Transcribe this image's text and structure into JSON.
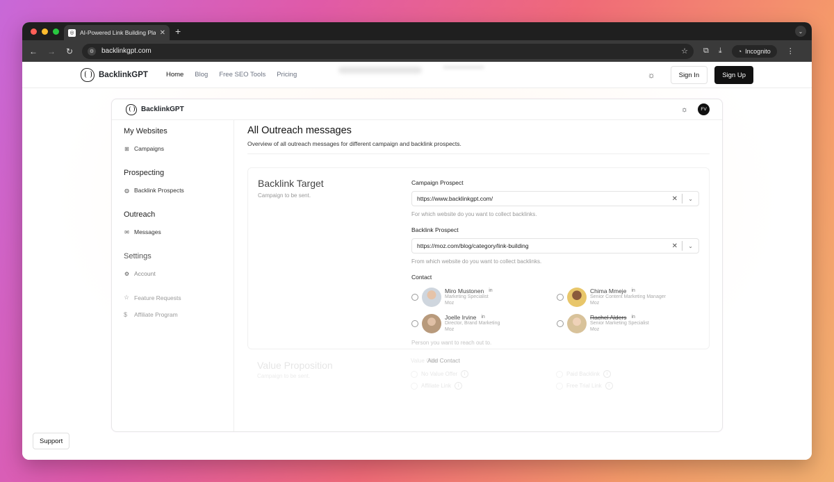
{
  "browser": {
    "tab_title": "AI-Powered Link Building Platform",
    "url": "backlinkgpt.com",
    "incognito_label": "Incognito"
  },
  "site": {
    "brand": "BacklinkGPT",
    "menu": [
      "Home",
      "Blog",
      "Free SEO Tools",
      "Pricing"
    ],
    "sign_in": "Sign In",
    "sign_up": "Sign Up"
  },
  "app": {
    "brand": "BacklinkGPT",
    "avatar_initials": "FV",
    "sidebar": {
      "sections": [
        {
          "title": "My Websites",
          "item": "Campaigns"
        },
        {
          "title": "Prospecting",
          "item": "Backlink Prospects"
        },
        {
          "title": "Outreach",
          "item": "Messages"
        },
        {
          "title": "Settings",
          "item": "Account"
        }
      ],
      "extras": [
        "Feature Requests",
        "Affiliate Program"
      ]
    },
    "main": {
      "title": "All Outreach messages",
      "subtitle": "Overview of all outreach messages for different campaign and backlink prospects.",
      "target": {
        "title": "Backlink Target",
        "subtitle": "Campaign to be sent.",
        "campaign_label": "Campaign Prospect",
        "campaign_value": "https://www.backlinkgpt.com/",
        "campaign_help": "For which website do you want to collect backlinks.",
        "backlink_label": "Backlink Prospect",
        "backlink_value": "https://moz.com/blog/category/link-building",
        "backlink_help": "From which website do you want to collect backlinks.",
        "contact_label": "Contact",
        "contacts": [
          {
            "name": "Miro Mustonen",
            "role": "Marketing Specialist",
            "company": "Moz"
          },
          {
            "name": "Chima Mmeje",
            "role": "Senior Content Marketing Manager",
            "company": "Moz"
          },
          {
            "name": "Joelle Irvine",
            "role": "Director, Brand Marketing",
            "company": "Moz"
          },
          {
            "name": "Rachel Alders",
            "role": "Senior Marketing Specialist",
            "company": "Moz"
          }
        ],
        "contact_help": "Person you want to reach out to.",
        "add_contact": "Add Contact"
      },
      "value_prop": {
        "title": "Value Proposition",
        "subtitle": "Campaign to be sent.",
        "offer_label": "Value Offer",
        "options": [
          "No Value Offer",
          "Paid Backlink",
          "Affiliate Link",
          "Free Trial Link"
        ]
      }
    }
  },
  "support_label": "Support",
  "colors": {
    "traffic_red": "#ff5f57",
    "traffic_yellow": "#febc2e",
    "traffic_green": "#28c840",
    "primary": "#111111"
  }
}
